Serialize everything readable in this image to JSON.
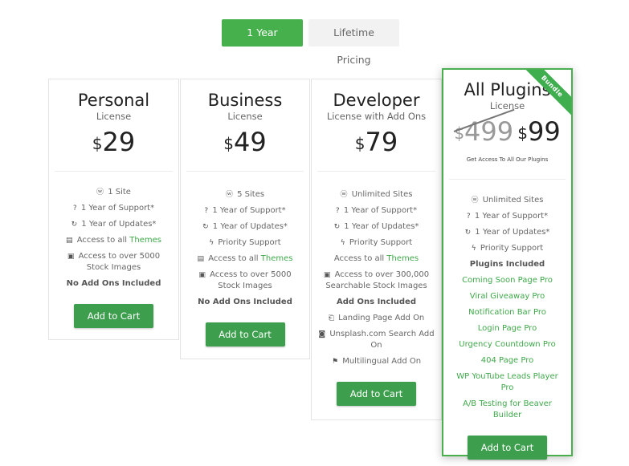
{
  "toggle": {
    "year": "1 Year Pricing",
    "lifetime": "Lifetime Pricing"
  },
  "plans": [
    {
      "title": "Personal",
      "subtitle": "License",
      "currency": "$",
      "price": "29",
      "features": [
        {
          "icon": "ⓦ",
          "text": "1 Site"
        },
        {
          "icon": "?",
          "text": "1 Year of Support*"
        },
        {
          "icon": "↻",
          "text": "1 Year of Updates*"
        },
        {
          "icon": "▤",
          "text": "Access to all ",
          "link": "Themes"
        },
        {
          "icon": "▣",
          "text": "Access to over 5000 Stock Images"
        },
        {
          "bold": "No Add Ons Included"
        }
      ],
      "cart": "Add to Cart"
    },
    {
      "title": "Business",
      "subtitle": "License",
      "currency": "$",
      "price": "49",
      "features": [
        {
          "icon": "ⓦ",
          "text": "5 Sites"
        },
        {
          "icon": "?",
          "text": "1 Year of Support*"
        },
        {
          "icon": "↻",
          "text": "1 Year of Updates*"
        },
        {
          "icon": "ϟ",
          "text": "Priority Support"
        },
        {
          "icon": "▤",
          "text": "Access to all ",
          "link": "Themes"
        },
        {
          "icon": "▣",
          "text": "Access to over 5000 Stock Images"
        },
        {
          "bold": "No Add Ons Included"
        }
      ],
      "cart": "Add to Cart"
    },
    {
      "title": "Developer",
      "subtitle": "License with Add Ons",
      "currency": "$",
      "price": "79",
      "features": [
        {
          "icon": "ⓦ",
          "text": "Unlimited Sites"
        },
        {
          "icon": "?",
          "text": "1 Year of Support*"
        },
        {
          "icon": "↻",
          "text": "1 Year of Updates*"
        },
        {
          "icon": "ϟ",
          "text": "Priority Support"
        },
        {
          "text": "Access to all ",
          "link": "Themes"
        },
        {
          "icon": "▣",
          "text": "Access to over 300,000 Searchable Stock Images"
        },
        {
          "bold": "Add Ons Included"
        },
        {
          "icon": "⎗",
          "text": "Landing Page Add On"
        },
        {
          "icon": "◙",
          "text": "Unsplash.com Search Add On"
        },
        {
          "icon": "⚑",
          "text": "Multilingual Add On"
        }
      ],
      "cart": "Add to Cart"
    }
  ],
  "featured": {
    "title": "All Plugins",
    "subtitle": "License",
    "ribbon": "Bundle",
    "old_currency": "$",
    "old_price": "499",
    "currency": "$",
    "price": "99",
    "tagline": "Get Access To All Our Plugins",
    "features": [
      {
        "icon": "ⓦ",
        "text": "Unlimited Sites"
      },
      {
        "icon": "?",
        "text": "1 Year of Support*"
      },
      {
        "icon": "↻",
        "text": "1 Year of Updates*"
      },
      {
        "icon": "ϟ",
        "text": "Priority Support"
      },
      {
        "bold": "Plugins Included"
      }
    ],
    "plugins": [
      "Coming Soon Page Pro",
      "Viral Giveaway Pro",
      "Notification Bar Pro",
      "Login Page Pro",
      "Urgency Countdown Pro",
      "404 Page Pro",
      "WP YouTube Leads Player Pro",
      "A/B Testing for Beaver Builder"
    ],
    "cart": "Add to Cart"
  }
}
